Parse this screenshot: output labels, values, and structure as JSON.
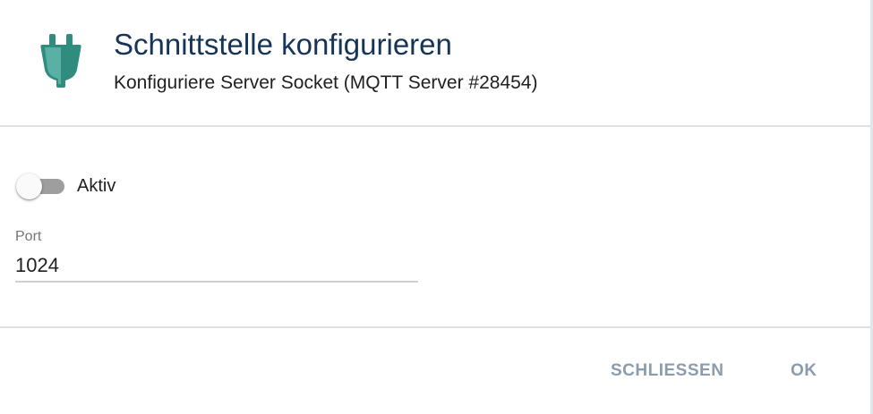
{
  "dialog": {
    "title": "Schnittstelle konfigurieren",
    "subtitle": "Konfiguriere Server Socket (MQTT Server #28454)",
    "icon": "plug-icon",
    "colors": {
      "icon_fill": "#5ab0a4",
      "icon_dark": "#2f8c7e",
      "title": "#163457",
      "button_text": "#8a9cad"
    }
  },
  "form": {
    "active_toggle": {
      "label": "Aktiv",
      "checked": false
    },
    "port": {
      "label": "Port",
      "value": "1024"
    }
  },
  "actions": {
    "close_label": "SCHLIESSEN",
    "ok_label": "OK"
  }
}
